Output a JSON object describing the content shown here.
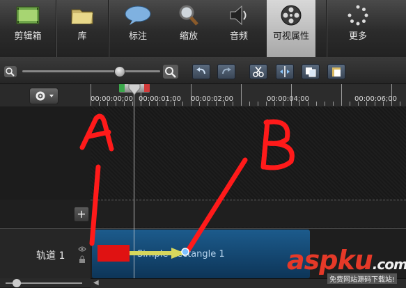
{
  "ribbon": {
    "tabs": [
      {
        "label": "剪辑箱",
        "icon": "film-strip-icon"
      },
      {
        "label": "库",
        "icon": "folder-icon"
      },
      {
        "label": "标注",
        "icon": "speech-bubble-icon"
      },
      {
        "label": "缩放",
        "icon": "magnifier-icon"
      },
      {
        "label": "音频",
        "icon": "speaker-icon"
      },
      {
        "label": "可视属性",
        "icon": "film-reel-icon",
        "selected": true
      },
      {
        "label": "更多",
        "icon": "spinner-dots-icon"
      }
    ]
  },
  "timeline": {
    "ruler_labels": [
      "00:00:00;00",
      "00:00:01;00",
      "00:00:02;00",
      "00:00:04;00",
      "00:00:06;00"
    ]
  },
  "tracks": [
    {
      "label": "轨道 1",
      "clip_title": "Simple Rectangle 1",
      "clip_color": "#e01212"
    }
  ],
  "annotations": {
    "marks": [
      "A",
      "B"
    ],
    "color": "#ff1a1a"
  },
  "watermark": {
    "text": "aspku",
    "suffix": ".com",
    "subtitle": "免费网站源码下载站!"
  }
}
